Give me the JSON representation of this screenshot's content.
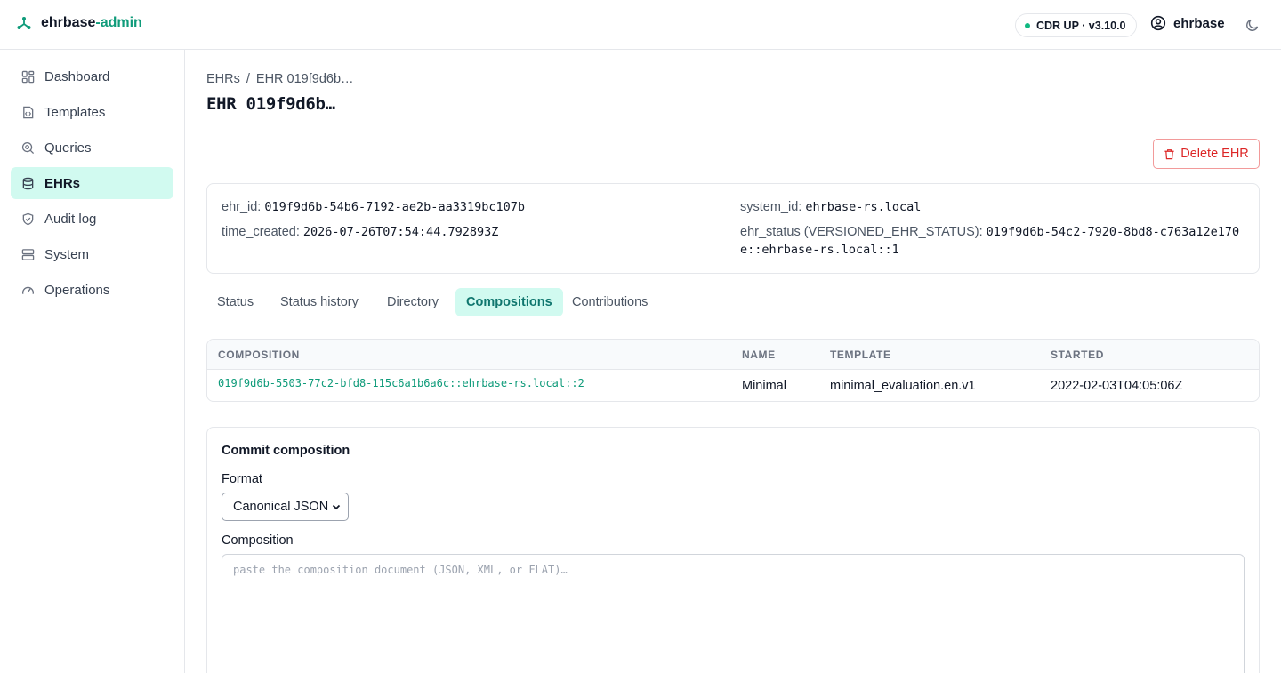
{
  "app": {
    "brand_name": "ehrbase",
    "brand_accent": "-admin",
    "accent_color": "#0f9b7a"
  },
  "header": {
    "status_text": "CDR UP · v3.10.0",
    "status_color": "#10b981",
    "user_name": "ehrbase"
  },
  "sidebar": {
    "items": [
      {
        "label": "Dashboard",
        "icon": "dashboard-icon",
        "active": false
      },
      {
        "label": "Templates",
        "icon": "template-file-icon",
        "active": false
      },
      {
        "label": "Queries",
        "icon": "query-search-icon",
        "active": false
      },
      {
        "label": "EHRs",
        "icon": "database-icon",
        "active": true
      },
      {
        "label": "Audit log",
        "icon": "shield-check-icon",
        "active": false
      },
      {
        "label": "System",
        "icon": "server-icon",
        "active": false
      },
      {
        "label": "Operations",
        "icon": "gauge-icon",
        "active": false
      }
    ]
  },
  "breadcrumb": {
    "root": "EHRs",
    "separator": "/",
    "current": "EHR 019f9d6b…"
  },
  "page": {
    "title": "EHR 019f9d6b…",
    "delete_label": "Delete EHR"
  },
  "info": {
    "ehr_id_label": "ehr_id:",
    "ehr_id_value": "019f9d6b-54b6-7192-ae2b-aa3319bc107b",
    "time_created_label": "time_created:",
    "time_created_value": "2026-07-26T07:54:44.792893Z",
    "system_id_label": "system_id:",
    "system_id_value": "ehrbase-rs.local",
    "ehr_status_label": "ehr_status (VERSIONED_EHR_STATUS):",
    "ehr_status_value_line1": "019f9d6b-54c2-7920-8bd8-c763a12e170",
    "ehr_status_value_line2": "e::ehrbase-rs.local::1"
  },
  "tabs": [
    {
      "label": "Status",
      "active": false
    },
    {
      "label": "Status history",
      "active": false
    },
    {
      "label": "Directory",
      "active": false
    },
    {
      "label": "Compositions",
      "active": true
    },
    {
      "label": "Contributions",
      "active": false
    }
  ],
  "table": {
    "columns": [
      "COMPOSITION",
      "NAME",
      "TEMPLATE",
      "STARTED"
    ],
    "rows": [
      {
        "composition": "019f9d6b-5503-77c2-bfd8-115c6a1b6a6c::ehrbase-rs.local::2",
        "name": "Minimal",
        "template": "minimal_evaluation.en.v1",
        "started": "2022-02-03T04:05:06Z"
      }
    ]
  },
  "commit": {
    "title": "Commit composition",
    "format_label": "Format",
    "format_value": "Canonical JSON",
    "composition_label": "Composition",
    "composition_placeholder": "paste the composition document (JSON, XML, or FLAT)…"
  }
}
